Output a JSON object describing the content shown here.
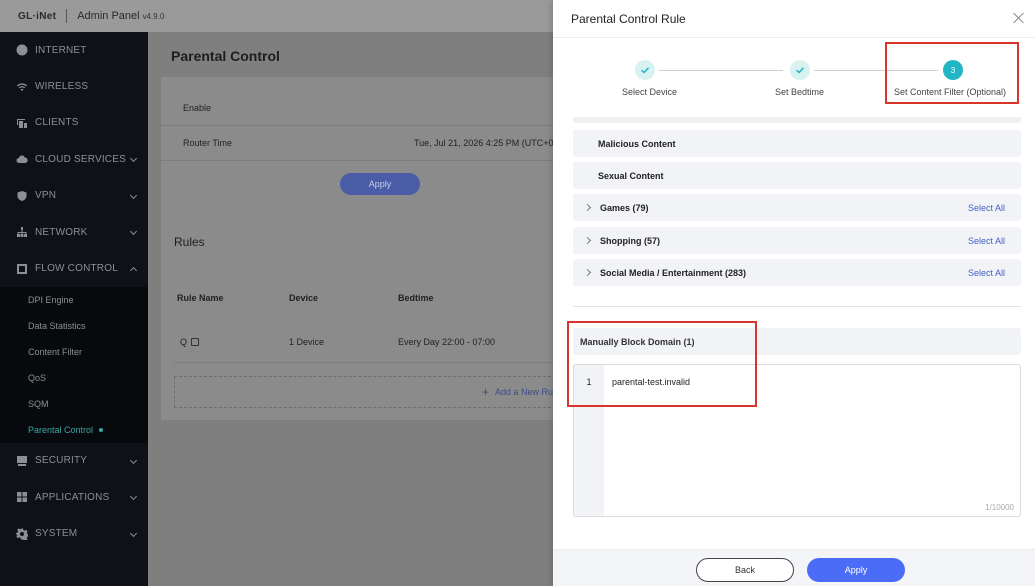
{
  "topbar": {
    "logo": "GL·iNet",
    "admin_title": "Admin Panel",
    "version": "v4.9.0"
  },
  "sidebar": {
    "items": [
      {
        "label": "INTERNET",
        "icon": "globe-icon"
      },
      {
        "label": "WIRELESS",
        "icon": "wifi-icon"
      },
      {
        "label": "CLIENTS",
        "icon": "devices-icon"
      },
      {
        "label": "CLOUD SERVICES",
        "icon": "cloud-icon"
      },
      {
        "label": "VPN",
        "icon": "shield-icon"
      },
      {
        "label": "NETWORK",
        "icon": "network-icon"
      },
      {
        "label": "FLOW CONTROL",
        "icon": "flow-icon"
      }
    ],
    "flow_sub": [
      "DPI Engine",
      "Data Statistics",
      "Content Filter",
      "QoS",
      "SQM",
      "Parental Control"
    ],
    "bottom_items": [
      {
        "label": "SECURITY",
        "icon": "security-icon"
      },
      {
        "label": "APPLICATIONS",
        "icon": "apps-icon"
      },
      {
        "label": "SYSTEM",
        "icon": "gear-icon"
      }
    ]
  },
  "main": {
    "title": "Parental Control",
    "enable_label": "Enable",
    "router_time_label": "Router Time",
    "router_time_value": "Tue, Jul 21, 2026 4:25 PM (UTC+0",
    "apply_label": "Apply",
    "rules_title": "Rules",
    "columns": [
      "Rule Name",
      "Device",
      "Bedtime"
    ],
    "row": {
      "name": "Q",
      "device": "1 Device",
      "bedtime": "Every Day 22:00 - 07:00"
    },
    "add_rule": "Add a New Rule"
  },
  "drawer": {
    "title": "Parental Control Rule",
    "steps": [
      {
        "label": "Select Device",
        "state": "done"
      },
      {
        "label": "Set Bedtime",
        "state": "done"
      },
      {
        "label": "Set Content Filter (Optional)",
        "state": "current",
        "number": "3"
      }
    ],
    "categories": [
      {
        "name": "Malicious Content",
        "expandable": false
      },
      {
        "name": "Sexual Content",
        "expandable": false
      },
      {
        "name": "Games (79)",
        "expandable": true,
        "action": "Select All"
      },
      {
        "name": "Shopping (57)",
        "expandable": true,
        "action": "Select All"
      },
      {
        "name": "Social Media / Entertainment (283)",
        "expandable": true,
        "action": "Select All"
      }
    ],
    "manual_block_title": "Manually Block Domain (1)",
    "editor": {
      "line_number": "1",
      "line_text": "parental-test.invalid",
      "counter": "1/10000"
    },
    "back_label": "Back",
    "apply_label": "Apply"
  },
  "colors": {
    "accent": "#4a6cf7",
    "teal": "#22b6c4",
    "highlight": "#d9362b"
  }
}
